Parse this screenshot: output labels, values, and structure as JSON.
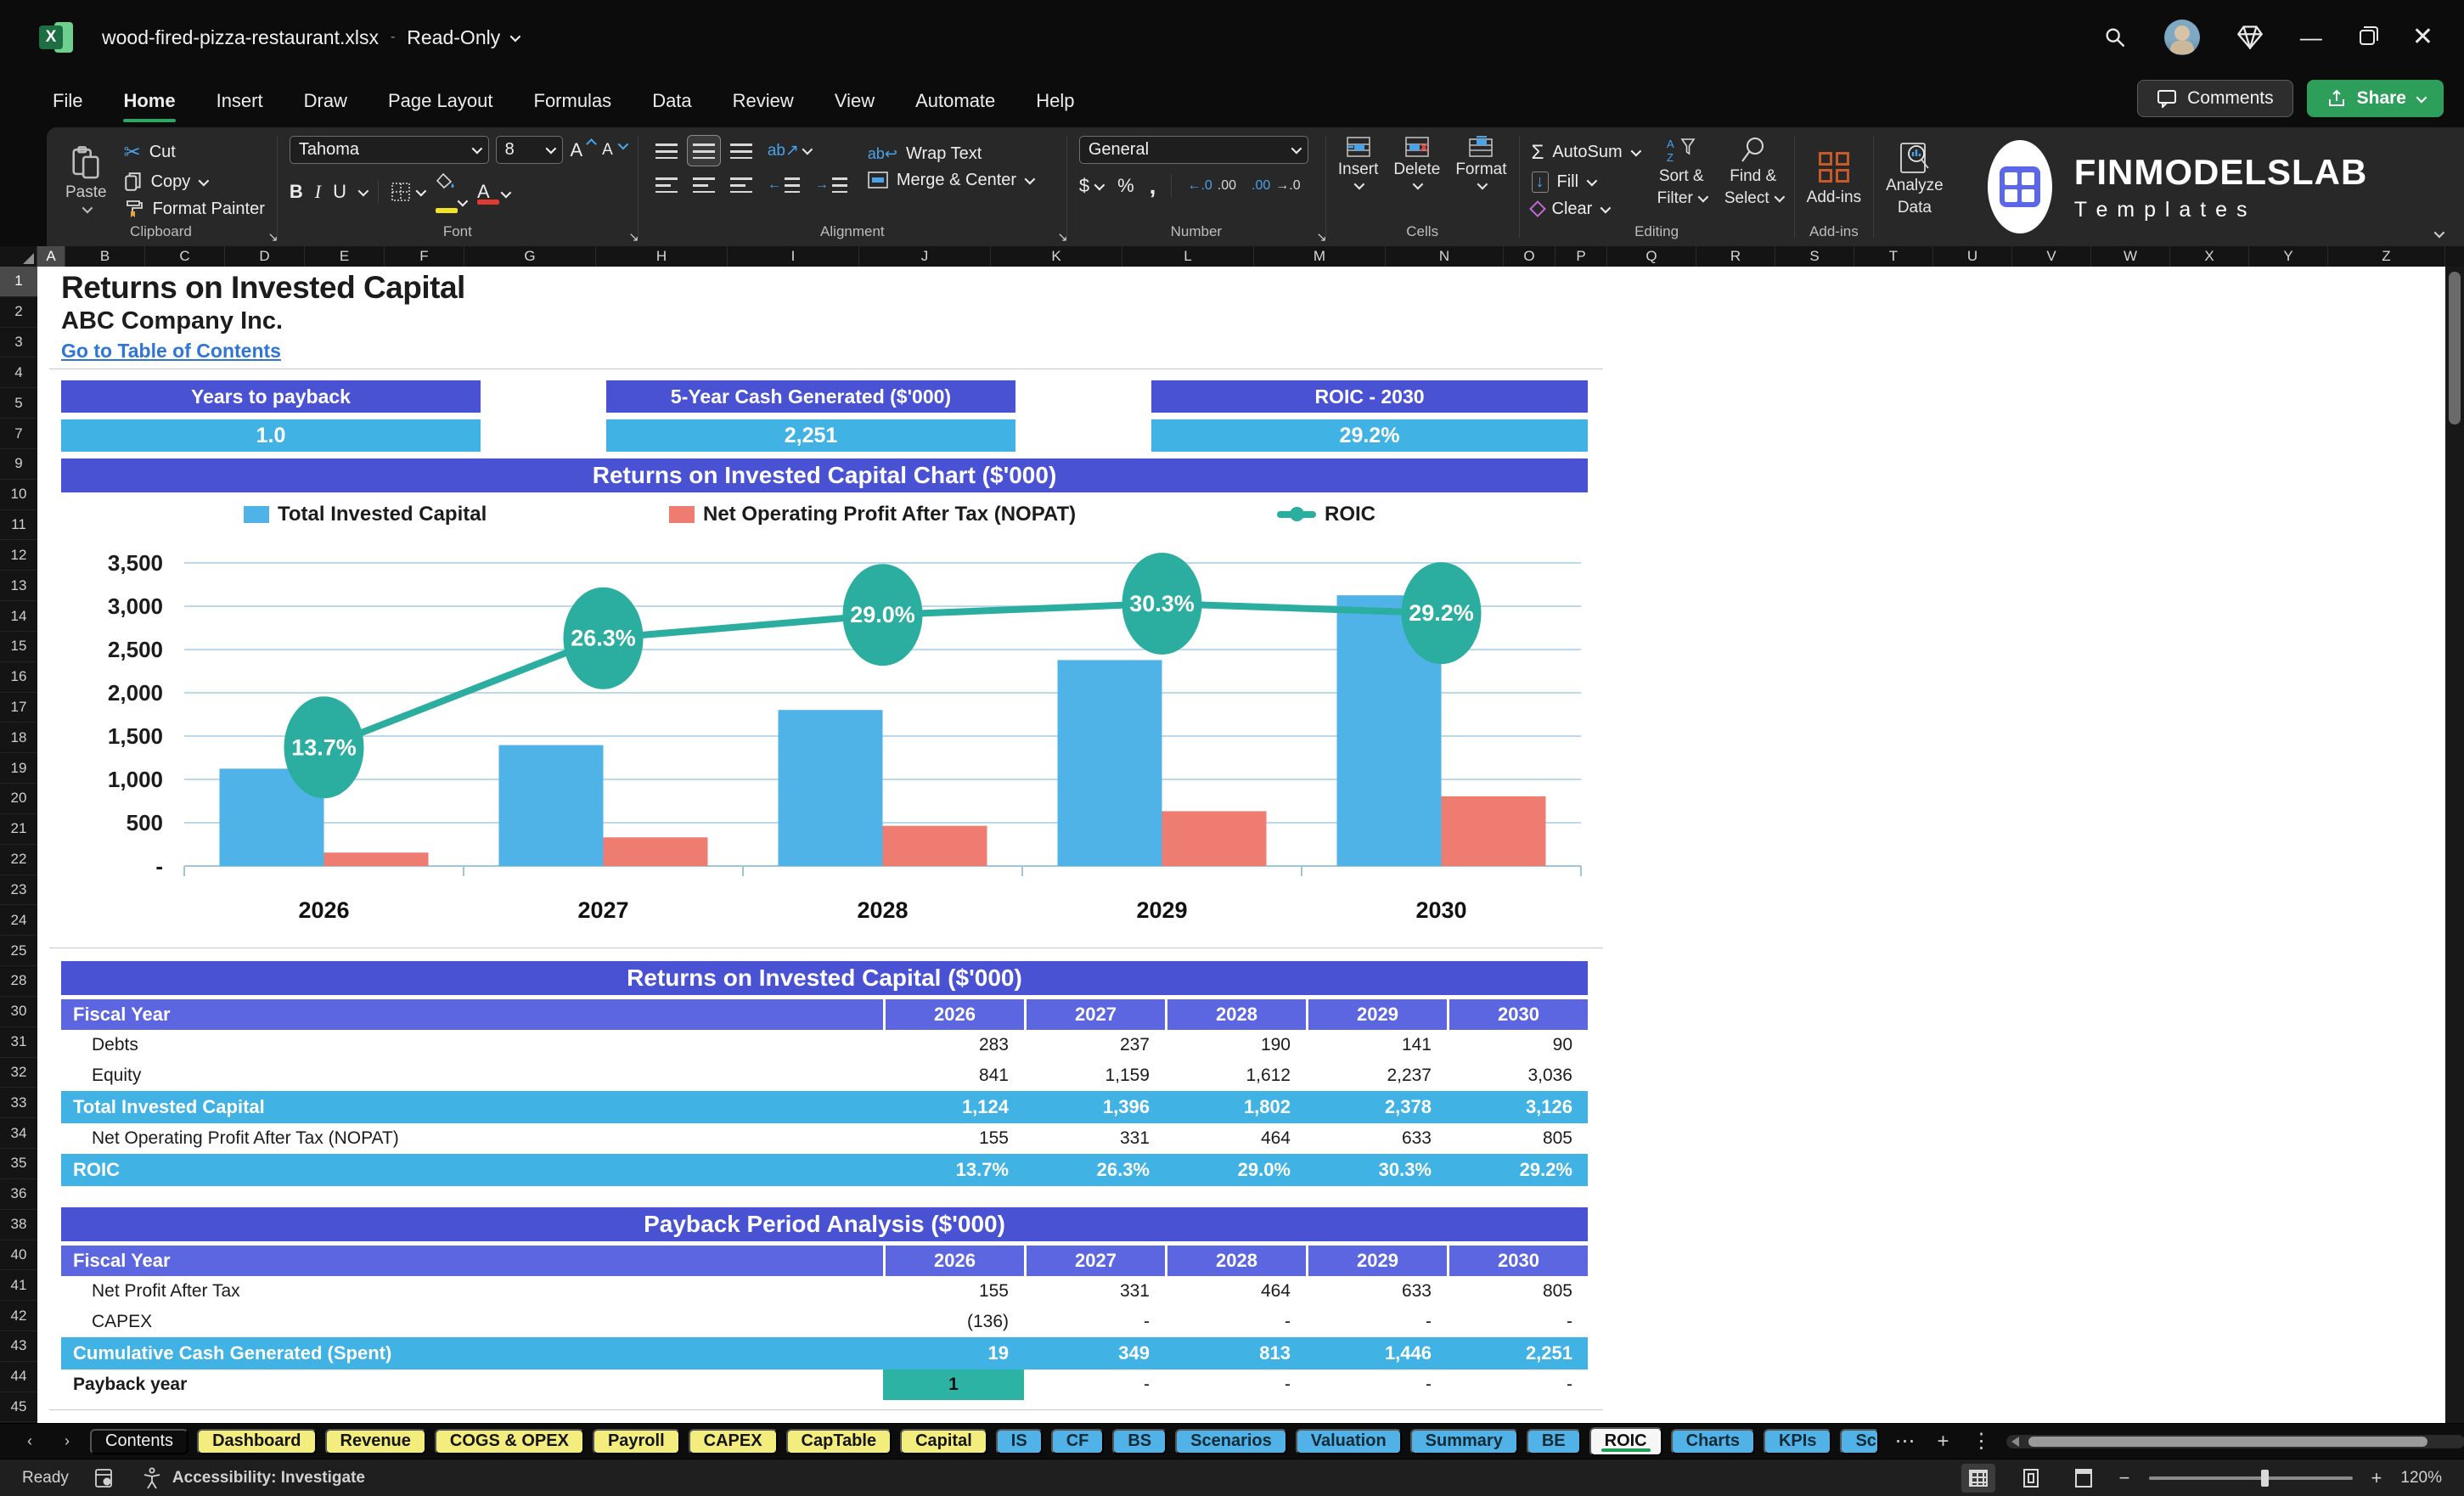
{
  "titlebar": {
    "filename": "wood-fired-pizza-restaurant.xlsx",
    "separator": "-",
    "mode": "Read-Only"
  },
  "ribbon": {
    "tabs": [
      "File",
      "Home",
      "Insert",
      "Draw",
      "Page Layout",
      "Formulas",
      "Data",
      "Review",
      "View",
      "Automate",
      "Help"
    ],
    "active_tab": "Home",
    "comments": "Comments",
    "share": "Share",
    "clipboard": {
      "paste": "Paste",
      "cut": "Cut",
      "copy": "Copy",
      "format_painter": "Format Painter",
      "group": "Clipboard"
    },
    "font": {
      "name": "Tahoma",
      "size": "8",
      "group": "Font"
    },
    "alignment": {
      "wrap": "Wrap Text",
      "merge": "Merge & Center",
      "group": "Alignment"
    },
    "number": {
      "format": "General",
      "group": "Number"
    },
    "cells": {
      "insert": "Insert",
      "delete": "Delete",
      "format": "Format",
      "group": "Cells"
    },
    "editing": {
      "autosum": "AutoSum",
      "fill": "Fill",
      "clear": "Clear",
      "sort1": "Sort &",
      "sort2": "Filter",
      "find1": "Find &",
      "find2": "Select",
      "group": "Editing"
    },
    "addins": {
      "button": "Add-ins",
      "group": "Add-ins",
      "analyze1": "Analyze",
      "analyze2": "Data"
    },
    "brand": {
      "line1": "FINMODELSLAB",
      "line2": "T e m p l a t e s"
    }
  },
  "grid": {
    "columns": [
      "A",
      "B",
      "C",
      "D",
      "E",
      "F",
      "G",
      "H",
      "I",
      "J",
      "K",
      "L",
      "M",
      "N",
      "O",
      "P",
      "Q",
      "R",
      "S",
      "T",
      "U",
      "V",
      "W",
      "X",
      "Y",
      "Z"
    ],
    "selected_column": "A",
    "rows": [
      "1",
      "2",
      "3",
      "4",
      "5",
      "7",
      "9",
      "10",
      "11",
      "12",
      "13",
      "14",
      "15",
      "16",
      "17",
      "18",
      "19",
      "20",
      "21",
      "22",
      "23",
      "24",
      "25",
      "28",
      "30",
      "31",
      "32",
      "33",
      "34",
      "35",
      "36",
      "38",
      "40",
      "41",
      "42",
      "43",
      "44",
      "45"
    ],
    "selected_row": "1"
  },
  "sheet": {
    "title": "Returns on Invested Capital",
    "subtitle": "ABC Company Inc.",
    "link": "Go to Table of Contents",
    "kpis": [
      {
        "label": "Years to payback",
        "value": "1.0"
      },
      {
        "label": "5-Year Cash Generated ($'000)",
        "value": "2,251"
      },
      {
        "label": "ROIC - 2030",
        "value": "29.2%"
      }
    ],
    "chart_banner": "Returns on Invested Capital Chart ($'000)"
  },
  "chart_data": {
    "type": "bar+line",
    "title": "Returns on Invested Capital Chart ($'000)",
    "categories": [
      "2026",
      "2027",
      "2028",
      "2029",
      "2030"
    ],
    "series": [
      {
        "name": "Total Invested Capital",
        "type": "bar",
        "color": "#4FB3E8",
        "values": [
          1124,
          1396,
          1802,
          2378,
          3126
        ]
      },
      {
        "name": "Net Operating Profit After Tax (NOPAT)",
        "type": "bar",
        "color": "#EE7C70",
        "values": [
          155,
          331,
          464,
          633,
          805
        ]
      },
      {
        "name": "ROIC",
        "type": "line",
        "color": "#2BAE9F",
        "values_pct": [
          13.7,
          26.3,
          29.0,
          30.3,
          29.2
        ],
        "labels": [
          "13.7%",
          "26.3%",
          "29.0%",
          "30.3%",
          "29.2%"
        ]
      }
    ],
    "y_axis": [
      {
        "v": 3500,
        "label": "3,500"
      },
      {
        "v": 3000,
        "label": "3,000"
      },
      {
        "v": 2500,
        "label": "2,500"
      },
      {
        "v": 2000,
        "label": "2,000"
      },
      {
        "v": 1500,
        "label": "1,500"
      },
      {
        "v": 1000,
        "label": "1,000"
      },
      {
        "v": 500,
        "label": "500"
      },
      {
        "v": 0,
        "label": "-"
      }
    ],
    "ylim": [
      0,
      3500
    ],
    "grid": true,
    "legend_position": "top"
  },
  "table_roic": {
    "title": "Returns on Invested Capital ($'000)",
    "col_label": "Fiscal Year",
    "years": [
      "2026",
      "2027",
      "2028",
      "2029",
      "2030"
    ],
    "rows": [
      {
        "label": "Debts",
        "values": [
          "283",
          "237",
          "190",
          "141",
          "90"
        ],
        "style": "plain"
      },
      {
        "label": "Equity",
        "values": [
          "841",
          "1,159",
          "1,612",
          "2,237",
          "3,036"
        ],
        "style": "plain"
      },
      {
        "label": "Total Invested Capital",
        "values": [
          "1,124",
          "1,396",
          "1,802",
          "2,378",
          "3,126"
        ],
        "style": "total"
      },
      {
        "label": "Net Operating Profit After Tax (NOPAT)",
        "values": [
          "155",
          "331",
          "464",
          "633",
          "805"
        ],
        "style": "plain"
      },
      {
        "label": "ROIC",
        "values": [
          "13.7%",
          "26.3%",
          "29.0%",
          "30.3%",
          "29.2%"
        ],
        "style": "total"
      }
    ]
  },
  "table_payback": {
    "title": "Payback Period Analysis ($'000)",
    "col_label": "Fiscal Year",
    "years": [
      "2026",
      "2027",
      "2028",
      "2029",
      "2030"
    ],
    "rows": [
      {
        "label": "Net Profit After Tax",
        "values": [
          "155",
          "331",
          "464",
          "633",
          "805"
        ],
        "style": "plain"
      },
      {
        "label": "CAPEX",
        "values": [
          "(136)",
          "-",
          "-",
          "-",
          "-"
        ],
        "style": "plain"
      },
      {
        "label": "Cumulative Cash Generated (Spent)",
        "values": [
          "19",
          "349",
          "813",
          "1,446",
          "2,251"
        ],
        "style": "total"
      },
      {
        "label": "Payback year",
        "values": [
          "1",
          "-",
          "-",
          "-",
          "-"
        ],
        "style": "paybk"
      }
    ]
  },
  "sheet_tabs": {
    "tabs": [
      {
        "label": "Contents",
        "style": "plain"
      },
      {
        "label": "Dashboard",
        "style": "yellow"
      },
      {
        "label": "Revenue",
        "style": "yellow"
      },
      {
        "label": "COGS & OPEX",
        "style": "yellow"
      },
      {
        "label": "Payroll",
        "style": "yellow"
      },
      {
        "label": "CAPEX",
        "style": "yellow"
      },
      {
        "label": "CapTable",
        "style": "yellow"
      },
      {
        "label": "Capital",
        "style": "yellow"
      },
      {
        "label": "IS",
        "style": "blue"
      },
      {
        "label": "CF",
        "style": "blue"
      },
      {
        "label": "BS",
        "style": "blue"
      },
      {
        "label": "Scenarios",
        "style": "blue"
      },
      {
        "label": "Valuation",
        "style": "blue"
      },
      {
        "label": "Summary",
        "style": "blue"
      },
      {
        "label": "BE",
        "style": "blue"
      },
      {
        "label": "ROIC",
        "style": "active"
      },
      {
        "label": "Charts",
        "style": "blue"
      },
      {
        "label": "KPIs",
        "style": "blue"
      },
      {
        "label": "Sc",
        "style": "blue-cut"
      }
    ]
  },
  "status": {
    "ready": "Ready",
    "accessibility": "Accessibility: Investigate",
    "zoom": "120%"
  },
  "colors": {
    "banner_purple": "#4A52D4",
    "header_indigo": "#5B66E0",
    "band_cyan": "#41B2E4",
    "teal": "#2BAE9F",
    "payback_teal": "#2DB3A4",
    "bar_blue": "#4FB3E8",
    "bar_salmon": "#EE7C70",
    "tab_yellow": "#F2ED7D",
    "tab_blue": "#51B2E8",
    "share_green": "#2E9E5B",
    "link_blue": "#2E75D6"
  }
}
